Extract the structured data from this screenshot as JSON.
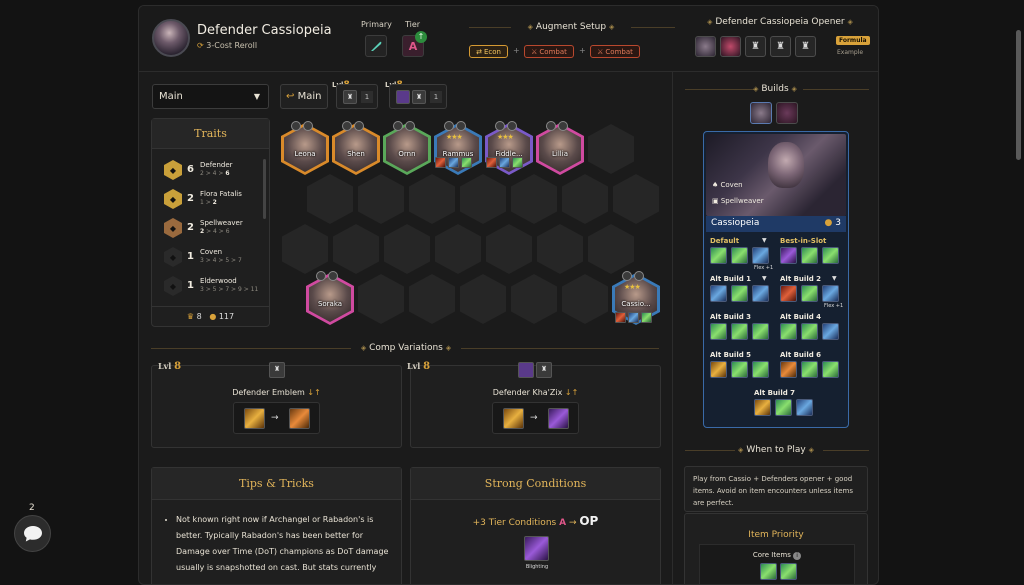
{
  "header": {
    "title": "Defender Cassiopeia",
    "subtitle": "3-Cost Reroll",
    "primary_label": "Primary",
    "tier_label": "Tier",
    "tier_value": "A",
    "augment_title": "Augment Setup",
    "augments": [
      "Econ",
      "Combat",
      "Combat"
    ],
    "plus": "+",
    "opener_title": "Defender Cassiopeia Opener",
    "formula": "Formula",
    "example": "Example"
  },
  "controls": {
    "board_select": "Main",
    "main_button": "Main",
    "lvl_prefix": "Lvl",
    "lvl_value": "8",
    "count_a": "1",
    "count_b": "1"
  },
  "traits": {
    "title": "Traits",
    "items": [
      {
        "count": "6",
        "name": "Defender",
        "pre": "2 > 4 > ",
        "active": "6",
        "post": "",
        "color": "#c9a03a"
      },
      {
        "count": "2",
        "name": "Flora Fatalis",
        "pre": "1 > ",
        "active": "2",
        "post": "",
        "color": "#c9a03a"
      },
      {
        "count": "2",
        "name": "Spellweaver",
        "pre": "",
        "active": "2",
        "post": " > 4 > 6",
        "color": "#9a6a3e"
      },
      {
        "count": "1",
        "name": "Coven",
        "pre": "",
        "active": "",
        "post": "3 > 4 > 5 > 7",
        "color": "#2a2a2a"
      },
      {
        "count": "1",
        "name": "Elderwood",
        "pre": "",
        "active": "",
        "post": "3 > 5 > 7 > 9 > 11",
        "color": "#2a2a2a"
      }
    ],
    "footer_helmets": "8",
    "footer_gold": "117"
  },
  "board": {
    "champions": [
      {
        "name": "Leona",
        "color": "#d98a2a"
      },
      {
        "name": "Shen",
        "color": "#d98a2a"
      },
      {
        "name": "Ornn",
        "color": "#5aa85a"
      },
      {
        "name": "Rammus",
        "color": "#3a7ab8"
      },
      {
        "name": "Fiddle...",
        "color": "#7a5ac8"
      },
      {
        "name": "Lillia",
        "color": "#d04aa0"
      },
      {
        "name": "Soraka",
        "color": "#d04aa0"
      },
      {
        "name": "Cassio...",
        "color": "#3a7ab8"
      }
    ]
  },
  "variations": {
    "title": "Comp Variations",
    "cards": [
      {
        "lvl": "Lvl",
        "lvl_num": "8",
        "name": "Defender Emblem",
        "swap": "↓↑"
      },
      {
        "lvl": "Lvl",
        "lvl_num": "8",
        "name": "Defender Kha'Zix",
        "swap": "↓↑"
      }
    ],
    "arrow": "→"
  },
  "tips": {
    "title": "Tips & Tricks",
    "text": "Not known right now if Archangel or Rabadon's is better. Typically Rabadon's has been better for Damage over Time (DoT) champions as DoT damage usually is snapshotted on cast. But stats currently"
  },
  "conditions": {
    "title": "Strong Conditions",
    "prefix": "+3 Tier Conditions",
    "from": "A",
    "arrow": "→",
    "to": "OP",
    "item_label": "Blighting"
  },
  "builds": {
    "title": "Builds",
    "trait1": "Coven",
    "trait2": "Spellweaver",
    "champ_name": "Cassiopeia",
    "champ_cost": "3",
    "sets": [
      {
        "label": "Default",
        "gold": true,
        "dropdown": true
      },
      {
        "label": "Best-in-Slot",
        "gold": true,
        "dropdown": false
      },
      {
        "label": "Alt Build 1",
        "gold": false,
        "dropdown": true
      },
      {
        "label": "Alt Build 2",
        "gold": false,
        "dropdown": true
      },
      {
        "label": "Alt Build 3",
        "gold": false,
        "dropdown": false
      },
      {
        "label": "Alt Build 4",
        "gold": false,
        "dropdown": false
      },
      {
        "label": "Alt Build 5",
        "gold": false,
        "dropdown": false
      },
      {
        "label": "Alt Build 6",
        "gold": false,
        "dropdown": false
      },
      {
        "label": "Alt Build 7",
        "gold": false,
        "dropdown": false
      }
    ],
    "flex": "Flex +1"
  },
  "when_to_play": {
    "title": "When to Play",
    "text": "Play from Cassio + Defenders opener + good items. Avoid on item encounters unless items are perfect."
  },
  "item_priority": {
    "title": "Item Priority",
    "core_label": "Core Items"
  },
  "chat": {
    "count": "2"
  }
}
